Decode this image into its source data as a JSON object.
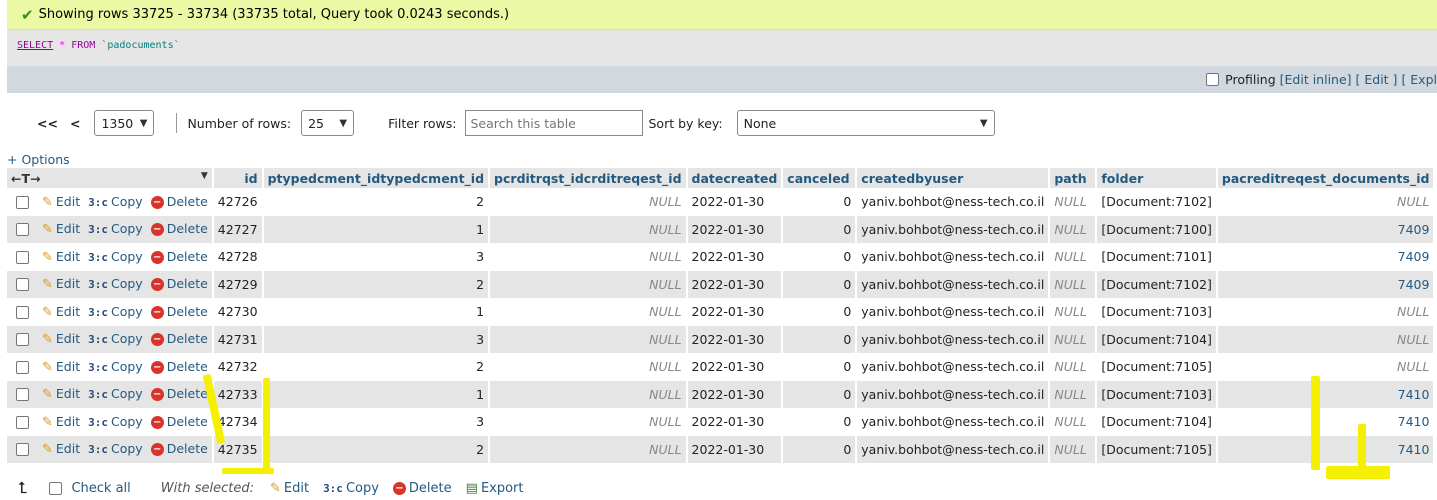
{
  "message": "Showing rows 33725 - 33734 (33735 total, Query took 0.0243 seconds.)",
  "sql": {
    "select": "SELECT",
    "star": "*",
    "from": "FROM",
    "table": "`padocuments`"
  },
  "profiling": {
    "label": "Profiling",
    "edit_inline": "[Edit inline]",
    "edit": "[ Edit ]",
    "explain": "[ Expl"
  },
  "nav": {
    "first": "<<",
    "prev": "<",
    "page": "1350",
    "rows_label": "Number of rows:",
    "rows_value": "25",
    "filter_label": "Filter rows:",
    "filter_placeholder": "Search this table",
    "sort_label": "Sort by key:",
    "sort_value": "None"
  },
  "options_label": "+ Options",
  "columns": [
    "id",
    "ptypedcment_idtypedcment_id",
    "pcrditrqst_idcrditreqest_id",
    "datecreated",
    "canceled",
    "createdbyuser",
    "path",
    "folder",
    "pacreditreqest_documents_id"
  ],
  "actions": {
    "edit": "Edit",
    "copy": "Copy",
    "delete": "Delete"
  },
  "rows": [
    [
      "42726",
      "2",
      "NULL",
      "2022-01-30",
      "0",
      "yaniv.bohbot@ness-tech.co.il",
      "NULL",
      "[Document:7102]",
      "NULL"
    ],
    [
      "42727",
      "1",
      "NULL",
      "2022-01-30",
      "0",
      "yaniv.bohbot@ness-tech.co.il",
      "NULL",
      "[Document:7100]",
      "7409"
    ],
    [
      "42728",
      "3",
      "NULL",
      "2022-01-30",
      "0",
      "yaniv.bohbot@ness-tech.co.il",
      "NULL",
      "[Document:7101]",
      "7409"
    ],
    [
      "42729",
      "2",
      "NULL",
      "2022-01-30",
      "0",
      "yaniv.bohbot@ness-tech.co.il",
      "NULL",
      "[Document:7102]",
      "7409"
    ],
    [
      "42730",
      "1",
      "NULL",
      "2022-01-30",
      "0",
      "yaniv.bohbot@ness-tech.co.il",
      "NULL",
      "[Document:7103]",
      "NULL"
    ],
    [
      "42731",
      "3",
      "NULL",
      "2022-01-30",
      "0",
      "yaniv.bohbot@ness-tech.co.il",
      "NULL",
      "[Document:7104]",
      "NULL"
    ],
    [
      "42732",
      "2",
      "NULL",
      "2022-01-30",
      "0",
      "yaniv.bohbot@ness-tech.co.il",
      "NULL",
      "[Document:7105]",
      "NULL"
    ],
    [
      "42733",
      "1",
      "NULL",
      "2022-01-30",
      "0",
      "yaniv.bohbot@ness-tech.co.il",
      "NULL",
      "[Document:7103]",
      "7410"
    ],
    [
      "42734",
      "3",
      "NULL",
      "2022-01-30",
      "0",
      "yaniv.bohbot@ness-tech.co.il",
      "NULL",
      "[Document:7104]",
      "7410"
    ],
    [
      "42735",
      "2",
      "NULL",
      "2022-01-30",
      "0",
      "yaniv.bohbot@ness-tech.co.il",
      "NULL",
      "[Document:7105]",
      "7410"
    ]
  ],
  "bottom": {
    "check_all": "Check all",
    "with_selected": "With selected:",
    "edit": "Edit",
    "copy": "Copy",
    "delete": "Delete",
    "export": "Export"
  },
  "colors": {
    "success_bg": "#ebf8a4",
    "link": "#235a81",
    "highlight": "#f4f000"
  }
}
